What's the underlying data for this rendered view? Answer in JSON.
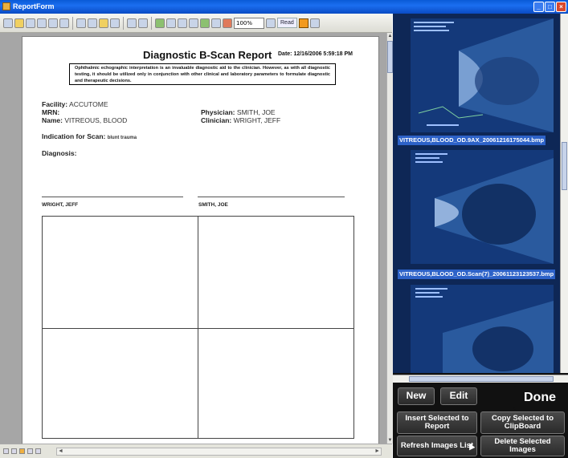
{
  "window": {
    "title": "ReportForm"
  },
  "toolbar": {
    "zoom": "100%",
    "read_label": "Read"
  },
  "report": {
    "title": "Diagnostic B-Scan Report",
    "date": "Date: 12/16/2006 5:59:18 PM",
    "disclaimer": "Ophthalmic echographic interpretation is an invaluable diagnostic aid to the clinician. However, as with all diagnostic testing, it should be utilized only in conjunction with other clinical and laboratory parameters to formulate diagnostic and therapeutic decisions.",
    "facility_label": "Facility:",
    "facility_value": "ACCUTOME",
    "mrn_label": "MRN:",
    "name_label": "Name:",
    "name_value": "VITREOUS, BLOOD",
    "physician_label": "Physician:",
    "physician_value": "SMITH, JOE",
    "clinician_label": "Clinician:",
    "clinician_value": "WRIGHT, JEFF",
    "indication_label": "Indication for Scan:",
    "indication_value": "blunt trauma",
    "diagnosis_label": "Diagnosis:",
    "signature_left": "WRIGHT, JEFF",
    "signature_right": "SMITH, JOE"
  },
  "images": [
    {
      "caption": "VITREOUS,BLOOD_OD.9AX_20061216175044.bmp"
    },
    {
      "caption": "VITREOUS,BLOOD_OD.Scan(7)_20061123123537.bmp"
    },
    {
      "caption": ""
    }
  ],
  "panel": {
    "new_label": "New",
    "edit_label": "Edit",
    "done_label": "Done",
    "insert_label": "Insert Selected to Report",
    "copy_label": "Copy Selected to ClipBoard",
    "refresh_label": "Refresh Images List",
    "delete_label": "Delete Selected Images"
  },
  "colors": {
    "titlebar": "#0a5bd7",
    "panel_bg": "#111111",
    "thumb_bg": "#0e2756",
    "caption_bg": "#2d62c8"
  }
}
